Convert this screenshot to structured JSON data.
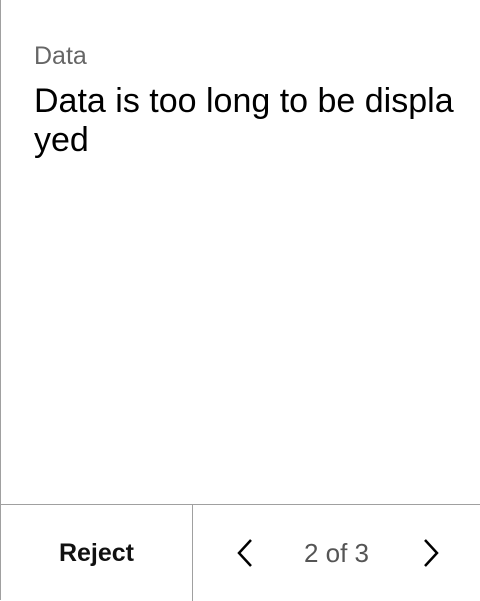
{
  "field": {
    "label": "Data",
    "value": "Data is too long to be displayed"
  },
  "footer": {
    "reject_label": "Reject",
    "page_indicator": "2 of 3"
  },
  "icons": {
    "prev": "chevron-left-icon",
    "next": "chevron-right-icon"
  }
}
